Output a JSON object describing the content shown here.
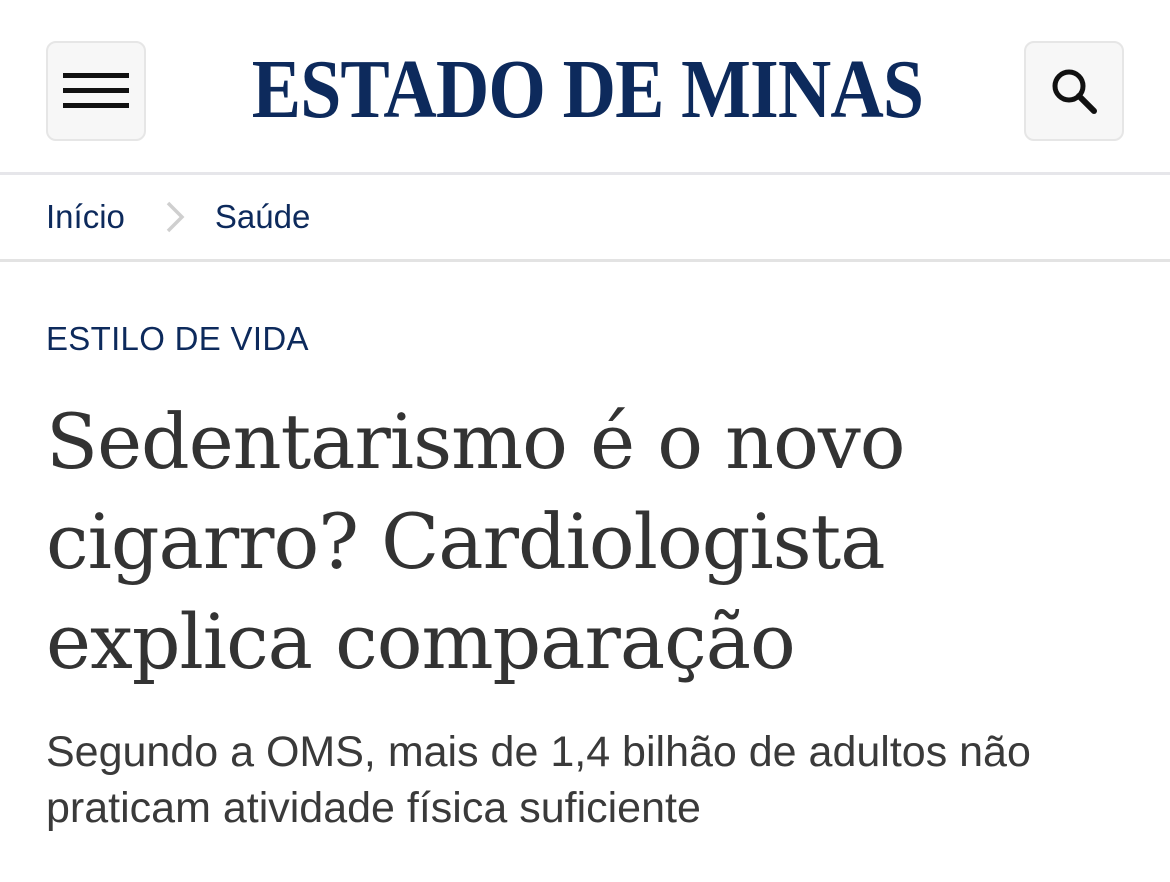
{
  "header": {
    "logo_text": "ESTADO DE MINAS",
    "brand_color": "#0d2a5c",
    "menu_icon": "hamburger-menu-icon",
    "search_icon": "search-icon"
  },
  "breadcrumb": {
    "items": [
      {
        "label": "Início"
      },
      {
        "label": "Saúde"
      }
    ],
    "separator_icon": "chevron-right-icon"
  },
  "article": {
    "kicker": "ESTILO DE VIDA",
    "headline": "Sedentarismo é o novo cigarro? Cardiologista explica comparação",
    "subheadline": "Segundo a OMS, mais de 1,4 bilhão de adultos não praticam atividade física suficiente"
  }
}
